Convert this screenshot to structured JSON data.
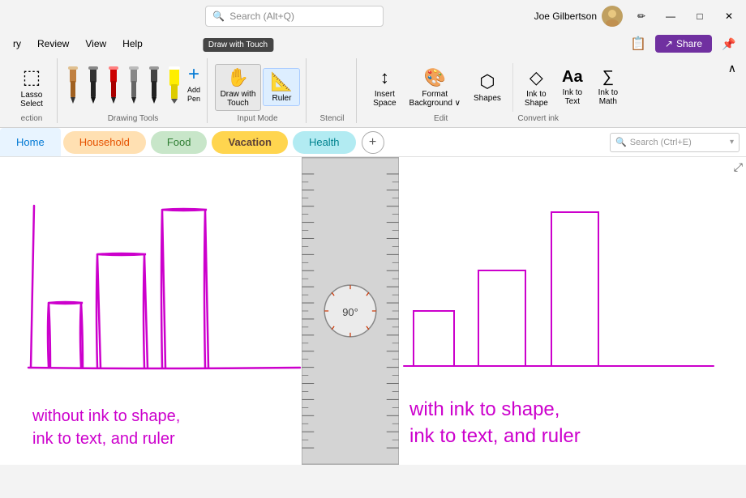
{
  "titlebar": {
    "search_placeholder": "Search (Alt+Q)",
    "user_name": "Joe Gilbertson",
    "pen_icon": "✏️",
    "minimize": "—",
    "maximize": "□",
    "close": "✕"
  },
  "menubar": {
    "items": [
      "ry",
      "Review",
      "View",
      "Help"
    ]
  },
  "ribbon": {
    "groups": [
      {
        "name": "selection",
        "label": "ection",
        "buttons": [
          {
            "id": "lasso",
            "label": "Lasso\nSelect",
            "icon": "⬚"
          }
        ]
      },
      {
        "name": "drawing-tools",
        "label": "Drawing Tools",
        "pens": [
          {
            "color": "#c08040",
            "type": "pen"
          },
          {
            "color": "#222",
            "type": "pen"
          },
          {
            "color": "#cc0000",
            "type": "pen"
          },
          {
            "color": "#888",
            "type": "pen"
          },
          {
            "color": "#222",
            "type": "pen"
          },
          {
            "color": "#ffff00",
            "type": "highlighter"
          },
          {
            "color": "#888",
            "special": "add",
            "label": "Add\nPen"
          }
        ]
      },
      {
        "name": "input-mode",
        "label": "Input Mode",
        "buttons": [
          {
            "id": "draw-touch",
            "label": "Draw with\nTouch",
            "icon": "👆",
            "active": false
          },
          {
            "id": "ruler",
            "label": "Ruler",
            "icon": "📏",
            "active": true
          }
        ]
      },
      {
        "name": "stencil",
        "label": "Stencil",
        "buttons": [
          {
            "id": "insert-space",
            "label": "Insert\nSpace",
            "icon": "↕"
          },
          {
            "id": "format-bg",
            "label": "Format\nBackground",
            "icon": "🎨"
          },
          {
            "id": "shapes",
            "label": "Shapes",
            "icon": "⬡"
          }
        ]
      },
      {
        "name": "edit",
        "label": "Edit",
        "buttons": [
          {
            "id": "ink-shape",
            "label": "Ink to\nShape",
            "icon": "◇"
          },
          {
            "id": "ink-text",
            "label": "Ink to\nText",
            "icon": "Aa"
          },
          {
            "id": "ink-math",
            "label": "Ink to\nMath",
            "icon": "∑"
          }
        ]
      },
      {
        "name": "convert-ink",
        "label": "Convert ink",
        "buttons": []
      }
    ]
  },
  "tabs": {
    "home_label": "Home",
    "household_label": "Household",
    "food_label": "Food",
    "vacation_label": "Vacation",
    "health_label": "Health",
    "add_label": "+",
    "search_placeholder": "Search (Ctrl+E)"
  },
  "canvas": {
    "left_annotation": "without ink to shape,\nink to text, and ruler",
    "right_annotation": "with ink to shape,\nink to text, and ruler",
    "ruler_angle": "90°"
  }
}
